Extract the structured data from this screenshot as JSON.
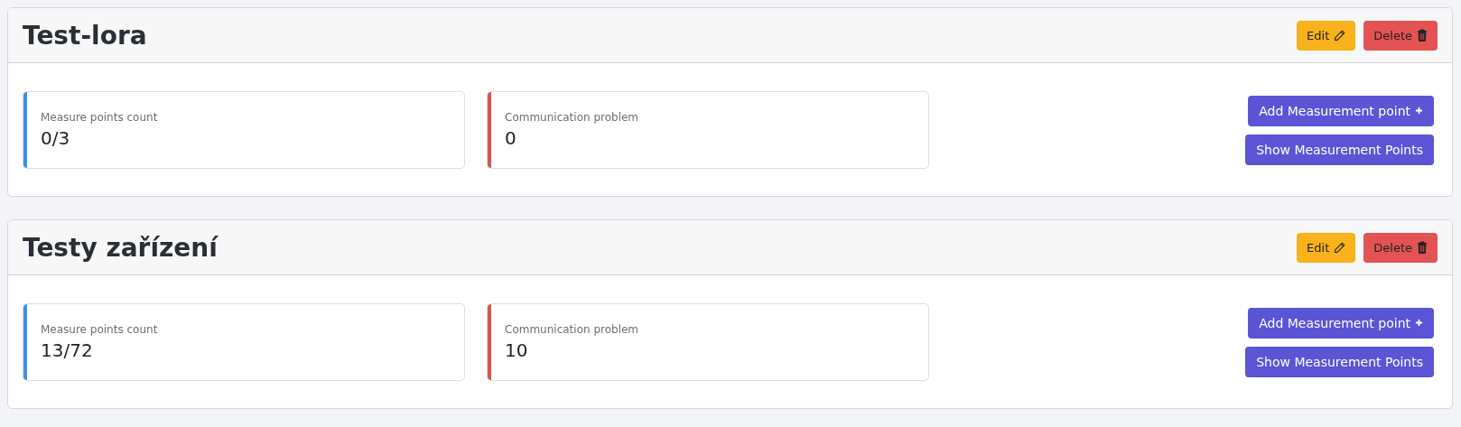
{
  "devices": [
    {
      "title": "Test-lora",
      "edit_label": "Edit",
      "delete_label": "Delete",
      "stats": [
        {
          "label": "Measure points count",
          "value": "0/3",
          "color": "#3b92e8"
        },
        {
          "label": "Communication problem",
          "value": "0",
          "color": "#d9534f"
        }
      ],
      "add_label": "Add Measurement point",
      "show_label": "Show Measurement Points"
    },
    {
      "title": "Testy zařízení",
      "edit_label": "Edit",
      "delete_label": "Delete",
      "stats": [
        {
          "label": "Measure points count",
          "value": "13/72",
          "color": "#3b92e8"
        },
        {
          "label": "Communication problem",
          "value": "10",
          "color": "#d9534f"
        }
      ],
      "add_label": "Add Measurement point",
      "show_label": "Show Measurement Points"
    }
  ]
}
